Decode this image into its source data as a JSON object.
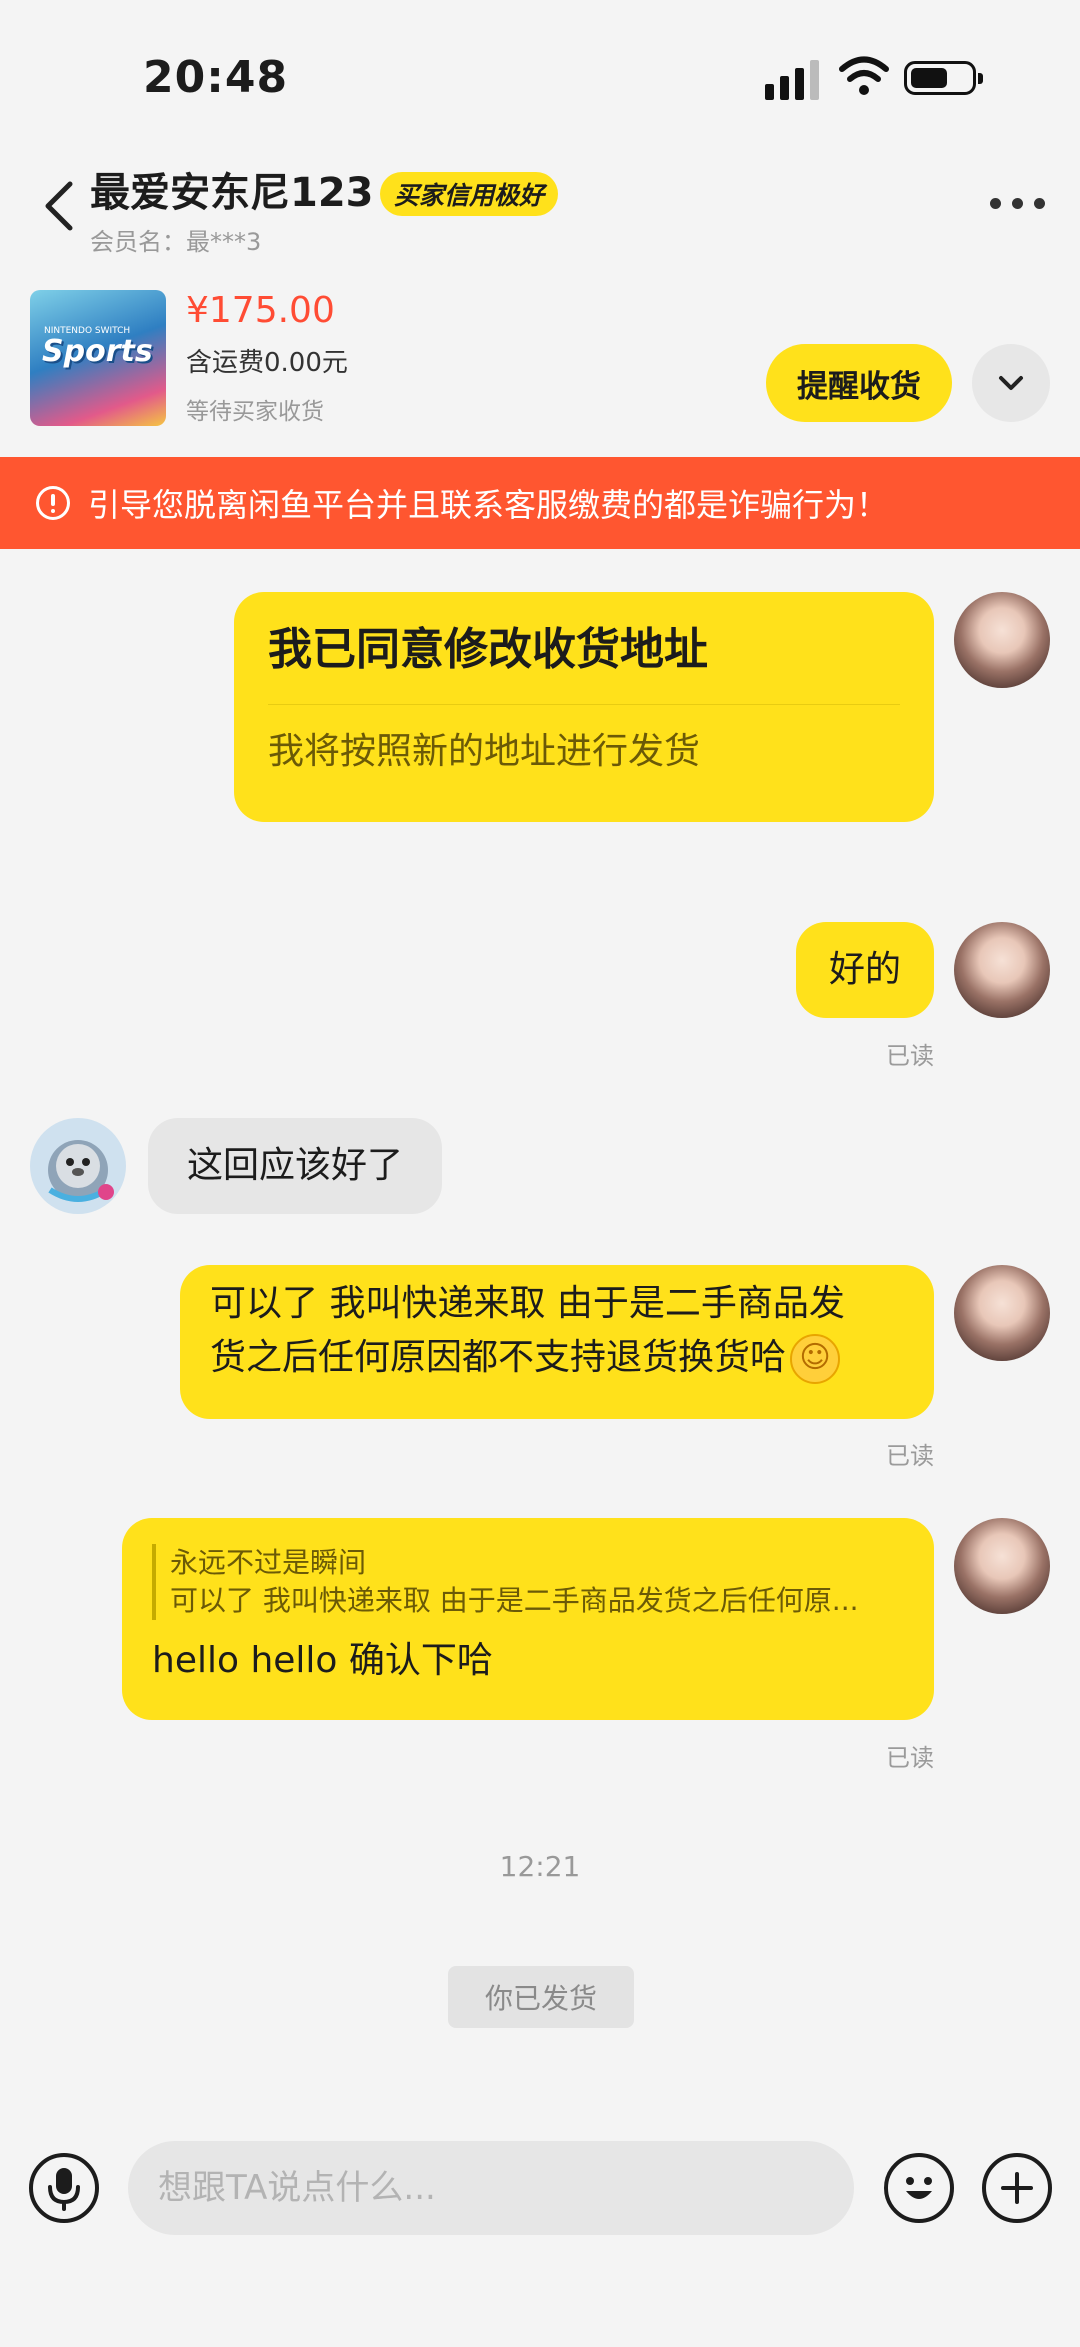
{
  "status_bar": {
    "time": "20:48"
  },
  "header": {
    "title": "最爱安东尼123",
    "badge": "买家信用极好",
    "member": "会员名：最***3"
  },
  "product": {
    "thumb_brand": "NINTENDO SWITCH",
    "thumb_logo": "Sports",
    "price": "¥175.00",
    "shipping": "含运费0.00元",
    "status": "等待买家收货",
    "remind_button": "提醒收货"
  },
  "warning": {
    "text": "引导您脱离闲鱼平台并且联系客服缴费的都是诈骗行为！"
  },
  "messages": {
    "card": {
      "title": "我已同意修改收货地址",
      "subtitle": "我将按照新的地址进行发货"
    },
    "m1": {
      "text": "好的",
      "status": "已读"
    },
    "m2": {
      "text": "这回应该好了"
    },
    "m3": {
      "line1": "可以了 我叫快递来取 由于是二手商品发",
      "line2": "货之后任何原因都不支持退货换货哈",
      "emoji": "☺",
      "status": "已读"
    },
    "m4": {
      "quote_name": "永远不过是瞬间",
      "quote_text": "可以了 我叫快递来取 由于是二手商品发货之后任何原...",
      "text": "hello hello 确认下哈",
      "status": "已读"
    },
    "timestamp": "12:21",
    "system": "你已发货"
  },
  "input_bar": {
    "placeholder": "想跟TA说点什么..."
  },
  "icons": {
    "back": "chevron-left-icon",
    "more": "more-dots-icon",
    "dropdown": "chevron-down-icon",
    "warning": "alert-circle-icon",
    "voice": "microphone-icon",
    "emoji": "emoji-face-icon",
    "plus": "plus-circle-icon"
  },
  "colors": {
    "accent": "#ffe11b",
    "warning": "#ff5630",
    "price": "#ff4c34"
  }
}
